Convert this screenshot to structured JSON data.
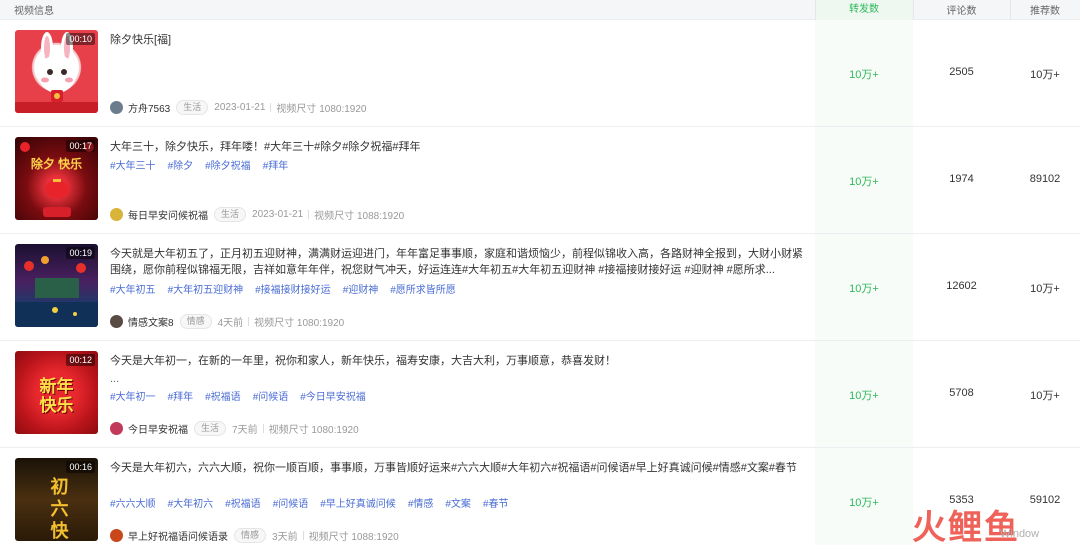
{
  "header": {
    "video_info": "视频信息",
    "shares": "转发数",
    "comments": "评论数",
    "recommends": "推荐数"
  },
  "rows": [
    {
      "duration": "00:10",
      "title": "除夕快乐[福]",
      "tags": [],
      "author": "方舟7563",
      "category": "生活",
      "date": "2023-01-21",
      "size": "视频尺寸 1080:1920",
      "shares": "10万+",
      "comments": "2505",
      "recommends": "10万+",
      "thumb_bg": "#e8404a",
      "avatar_color": "#6b7d8c"
    },
    {
      "duration": "00:17",
      "title": "大年三十，除夕快乐，拜年喽！#大年三十#除夕#除夕祝福#拜年",
      "tags": [
        "#大年三十",
        "#除夕",
        "#除夕祝福",
        "#拜年"
      ],
      "thumb_text": "除夕 快乐",
      "author": "每日早安问候祝福",
      "category": "生活",
      "date": "2023-01-21",
      "size": "视频尺寸 1088:1920",
      "shares": "10万+",
      "comments": "1974",
      "recommends": "89102",
      "thumb_bg": "#a01418",
      "avatar_color": "#d8b43a"
    },
    {
      "duration": "00:19",
      "title": "今天就是大年初五了，正月初五迎财神，满满财运迎进门，年年富足事事顺，家庭和谐烦恼少，前程似锦收入高，各路财神全报到，大财小财紧围绕，愿你前程似锦福无限，吉祥如意年年伴，祝您财气冲天，好运连连#大年初五#大年初五迎财神 #接福接财接好运 #迎财神 #愿所求...",
      "tags": [
        "#大年初五",
        "#大年初五迎财神",
        "#接福接财接好运",
        "#迎财神",
        "#愿所求皆所愿"
      ],
      "author": "情感文案8",
      "category": "情感",
      "date": "4天前",
      "size": "视频尺寸 1080:1920",
      "shares": "10万+",
      "comments": "12602",
      "recommends": "10万+",
      "thumb_bg": "#2a1a40",
      "avatar_color": "#5a4a44"
    },
    {
      "duration": "00:12",
      "title": "今天是大年初一，在新的一年里，祝你和家人，新年快乐，福寿安康，大吉大利，万事顺意，恭喜发财！",
      "title_more": "...",
      "tags": [
        "#大年初一",
        "#拜年",
        "#祝福语",
        "#问候语",
        "#今日早安祝福"
      ],
      "thumb_text": "新年 快乐",
      "author": "今日早安祝福",
      "category": "生活",
      "date": "7天前",
      "size": "视频尺寸 1080:1920",
      "shares": "10万+",
      "comments": "5708",
      "recommends": "10万+",
      "thumb_bg": "#c0161c",
      "avatar_color": "#c23a5a"
    },
    {
      "duration": "00:16",
      "title": "今天是大年初六，六六大顺，祝你一顺百顺，事事顺，万事皆顺好运来#六六大顺#大年初六#祝福语#问候语#早上好真诚问候#情感#文案#春节",
      "tags": [
        "#六六大顺",
        "#大年初六",
        "#祝福语",
        "#问候语",
        "#早上好真诚问候",
        "#情感",
        "#文案",
        "#春节"
      ],
      "thumb_text": "初六 快乐",
      "author": "早上好祝福语问候语录",
      "category": "情感",
      "date": "3天前",
      "size": "视频尺寸 1088:1920",
      "shares": "10万+",
      "comments": "5353",
      "recommends": "59102",
      "thumb_bg": "#3a2410",
      "avatar_color": "#c8481c"
    }
  ],
  "watermark": "火鲤鱼",
  "os_watermark": "Window"
}
